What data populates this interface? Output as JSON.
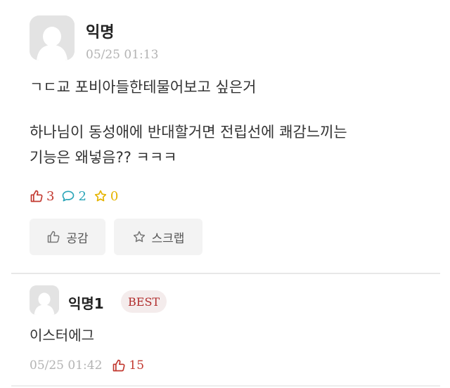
{
  "post": {
    "author": "익명",
    "time": "05/25 01:13",
    "title": "ㄱㄷ교 포비아들한테물어보고 싶은거",
    "body_line1": "하나님이 동성애에 반대할거면 전립선에 쾌감느끼는",
    "body_line2": "기능은 왜넣음?? ㅋㅋㅋ",
    "like_count": "3",
    "comment_count": "2",
    "scrap_count": "0",
    "like_button_label": "공감",
    "scrap_button_label": "스크랩"
  },
  "comment": {
    "author": "익명1",
    "badge": "BEST",
    "text": "이스터에그",
    "time": "05/25 01:42",
    "like_count": "15"
  },
  "colors": {
    "like": "#c2382f",
    "comment": "#2aa5b8",
    "scrap": "#e5b400",
    "best_badge_text": "#b02c2c",
    "muted": "#b3b3b3"
  },
  "icons": {
    "avatar": "default-avatar-icon",
    "like": "thumbs-up-icon",
    "comment": "speech-bubble-icon",
    "scrap": "star-icon"
  }
}
